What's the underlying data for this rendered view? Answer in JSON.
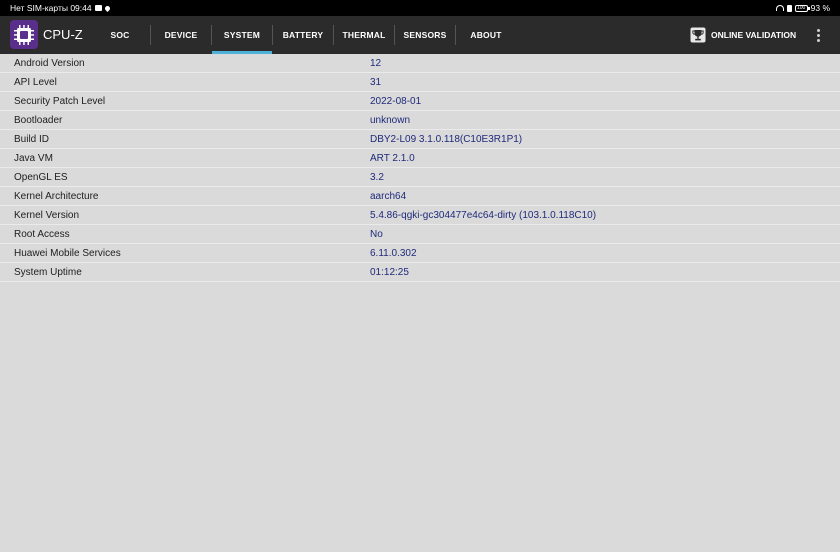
{
  "status_bar": {
    "carrier_time": "Нет SIM-карты 09:44",
    "battery_level": "100",
    "battery_percent": "93 %"
  },
  "app": {
    "title": "CPU-Z",
    "tabs": [
      "SOC",
      "DEVICE",
      "SYSTEM",
      "BATTERY",
      "THERMAL",
      "SENSORS",
      "ABOUT"
    ],
    "active_tab": "SYSTEM",
    "online_validation_label": "ONLINE VALIDATION",
    "accent_color": "#4fb0d8",
    "logo_color": "#5a2f8c"
  },
  "system_table": {
    "rows": [
      {
        "label": "Android Version",
        "value": "12"
      },
      {
        "label": "API Level",
        "value": "31"
      },
      {
        "label": "Security Patch Level",
        "value": "2022-08-01"
      },
      {
        "label": "Bootloader",
        "value": "unknown"
      },
      {
        "label": "Build ID",
        "value": "DBY2-L09 3.1.0.118(C10E3R1P1)"
      },
      {
        "label": "Java VM",
        "value": "ART 2.1.0"
      },
      {
        "label": "OpenGL ES",
        "value": "3.2"
      },
      {
        "label": "Kernel Architecture",
        "value": "aarch64"
      },
      {
        "label": "Kernel Version",
        "value": "5.4.86-qgki-gc304477e4c64-dirty (103.1.0.118C10)"
      },
      {
        "label": "Root Access",
        "value": "No"
      },
      {
        "label": "Huawei Mobile Services",
        "value": "6.11.0.302"
      },
      {
        "label": "System Uptime",
        "value": "01:12:25"
      }
    ]
  }
}
